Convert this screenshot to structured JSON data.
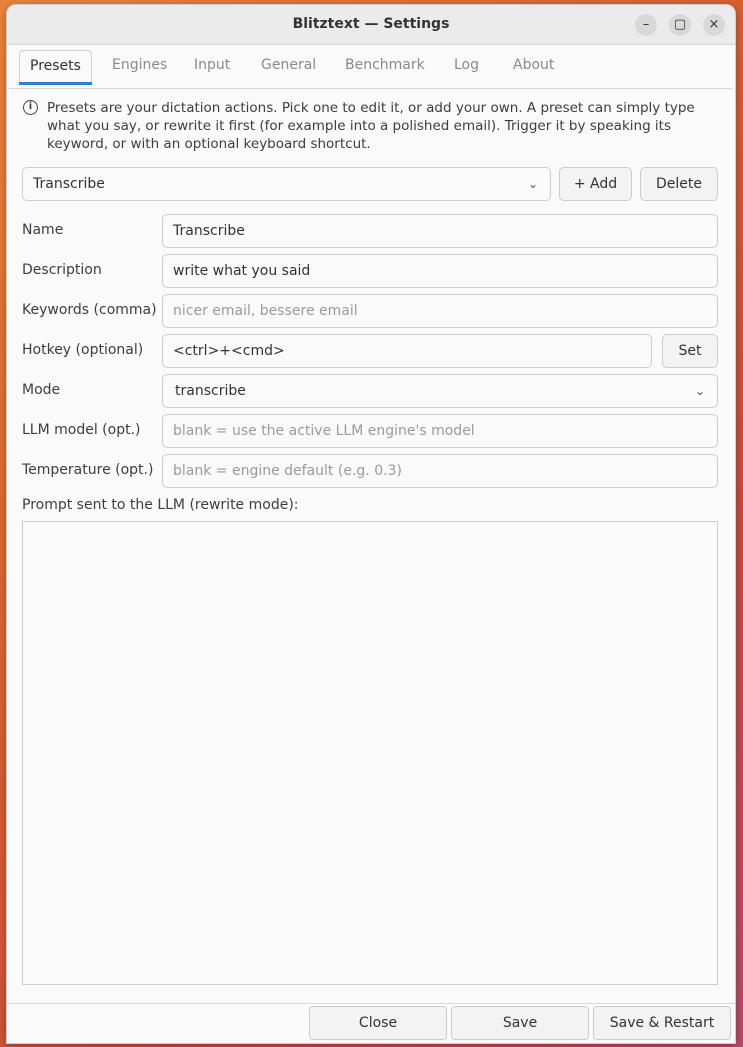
{
  "window": {
    "title": "Blitztext — Settings",
    "minimize_glyph": "–",
    "maximize_glyph": "▢",
    "close_glyph": "×"
  },
  "tabs": [
    {
      "label": "Presets"
    },
    {
      "label": "Engines"
    },
    {
      "label": "Input"
    },
    {
      "label": "General"
    },
    {
      "label": "Benchmark"
    },
    {
      "label": "Log"
    },
    {
      "label": "About"
    }
  ],
  "info": {
    "icon": "i",
    "text": "Presets are your dictation actions. Pick one to edit it, or add your own. A preset can simply type what you say, or rewrite it first (for example into a polished email). Trigger it by speaking its keyword, or with an optional keyboard shortcut."
  },
  "preset_selector": {
    "value": "Transcribe",
    "add_label": "+ Add",
    "delete_label": "Delete"
  },
  "form": {
    "name_label": "Name",
    "name_value": "Transcribe",
    "description_label": "Description",
    "description_value": "write what you said",
    "keywords_label": "Keywords (comma)",
    "keywords_placeholder": "nicer email, bessere email",
    "hotkey_label": "Hotkey (optional)",
    "hotkey_value": "<ctrl>+<cmd>",
    "hotkey_set_label": "Set",
    "mode_label": "Mode",
    "mode_value": "transcribe",
    "llm_model_label": "LLM model (opt.)",
    "llm_model_placeholder": "blank = use the active LLM engine's model",
    "temperature_label": "Temperature (opt.)",
    "temperature_placeholder": "blank = engine default (e.g. 0.3)",
    "prompt_label": "Prompt sent to the LLM (rewrite mode):"
  },
  "footer": {
    "close_label": "Close",
    "save_label": "Save",
    "save_restart_label": "Save & Restart"
  }
}
